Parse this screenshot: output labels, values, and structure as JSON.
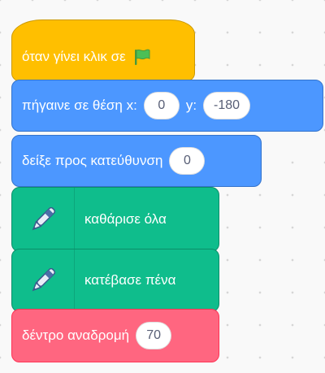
{
  "blocks": {
    "when_flag": {
      "label": "όταν γίνει κλικ σε",
      "icon": "green-flag-icon"
    },
    "go_to_xy": {
      "label": "πήγαινε σε θέση x:",
      "x": "0",
      "y_label": "y:",
      "y": "-180"
    },
    "point_in_direction": {
      "label": "δείξε προς κατεύθυνση",
      "value": "0"
    },
    "pen_clear": {
      "label": "καθάρισε όλα",
      "icon": "pen-icon"
    },
    "pen_down": {
      "label": "κατέβασε πένα",
      "icon": "pen-icon"
    },
    "tree_recursion": {
      "label": "δέντρο αναδρομή",
      "value": "70"
    }
  },
  "colors": {
    "events": "#ffbf00",
    "motion": "#4c97ff",
    "pen": "#0fbd8c",
    "custom": "#ff6680",
    "flag": "#4cbf56"
  }
}
